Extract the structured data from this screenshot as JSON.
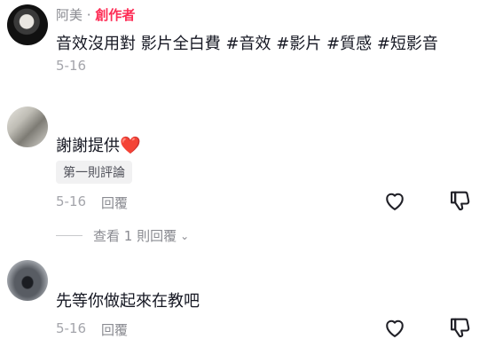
{
  "post": {
    "author": "阿美",
    "separator": "·",
    "creator_label": "創作者",
    "text": "音效沒用對 影片全白費 #音效 #影片 #質感 #短影音",
    "date": "5-16"
  },
  "comments": [
    {
      "text": "謝謝提供",
      "emoji": "❤️",
      "badge": "第一則評論",
      "date": "5-16",
      "reply_label": "回覆",
      "view_replies": "查看 1 則回覆",
      "icons": [
        "heart-outline-icon",
        "thumbs-down-icon"
      ]
    },
    {
      "text": "先等你做起來在教吧",
      "date": "5-16",
      "reply_label": "回覆",
      "icons": [
        "heart-outline-icon",
        "thumbs-down-icon"
      ]
    }
  ],
  "colors": {
    "accent": "#fe2c55",
    "muted": "#8a8b91",
    "text": "#161823"
  }
}
